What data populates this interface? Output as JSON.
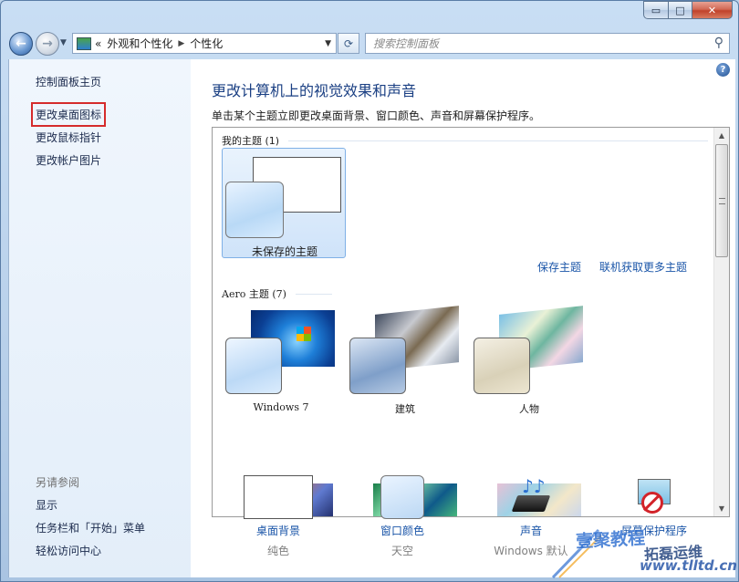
{
  "window": {
    "controls": {
      "minimize": "▭",
      "maximize": "□",
      "close": "✕"
    }
  },
  "navbar": {
    "breadcrumb_prefix": "«",
    "breadcrumbs": [
      "外观和个性化",
      "个性化"
    ],
    "search_placeholder": "搜索控制面板"
  },
  "sidebar": {
    "home": "控制面板主页",
    "links": [
      "更改桌面图标",
      "更改鼠标指针",
      "更改帐户图片"
    ],
    "see_also_label": "另请参阅",
    "see_also": [
      "显示",
      "任务栏和「开始」菜单",
      "轻松访问中心"
    ]
  },
  "main": {
    "title": "更改计算机上的视觉效果和声音",
    "subtitle": "单击某个主题立即更改桌面背景、窗口颜色、声音和屏幕保护程序。",
    "my_themes_header": "我的主题 (1)",
    "unsaved_theme": "未保存的主题",
    "save_theme": "保存主题",
    "get_more_themes": "联机获取更多主题",
    "aero_header": "Aero 主题 (7)",
    "aero_themes": [
      "Windows 7",
      "建筑",
      "人物"
    ]
  },
  "bottom": [
    {
      "label": "桌面背景",
      "value": "纯色"
    },
    {
      "label": "窗口颜色",
      "value": "天空"
    },
    {
      "label": "声音",
      "value": "Windows 默认"
    },
    {
      "label": "屏幕保护程序",
      "value": ""
    }
  ],
  "watermark": {
    "line1": "壹聚教程",
    "line2": "www.tlltd.cn",
    "line3": "拓磊运维"
  }
}
